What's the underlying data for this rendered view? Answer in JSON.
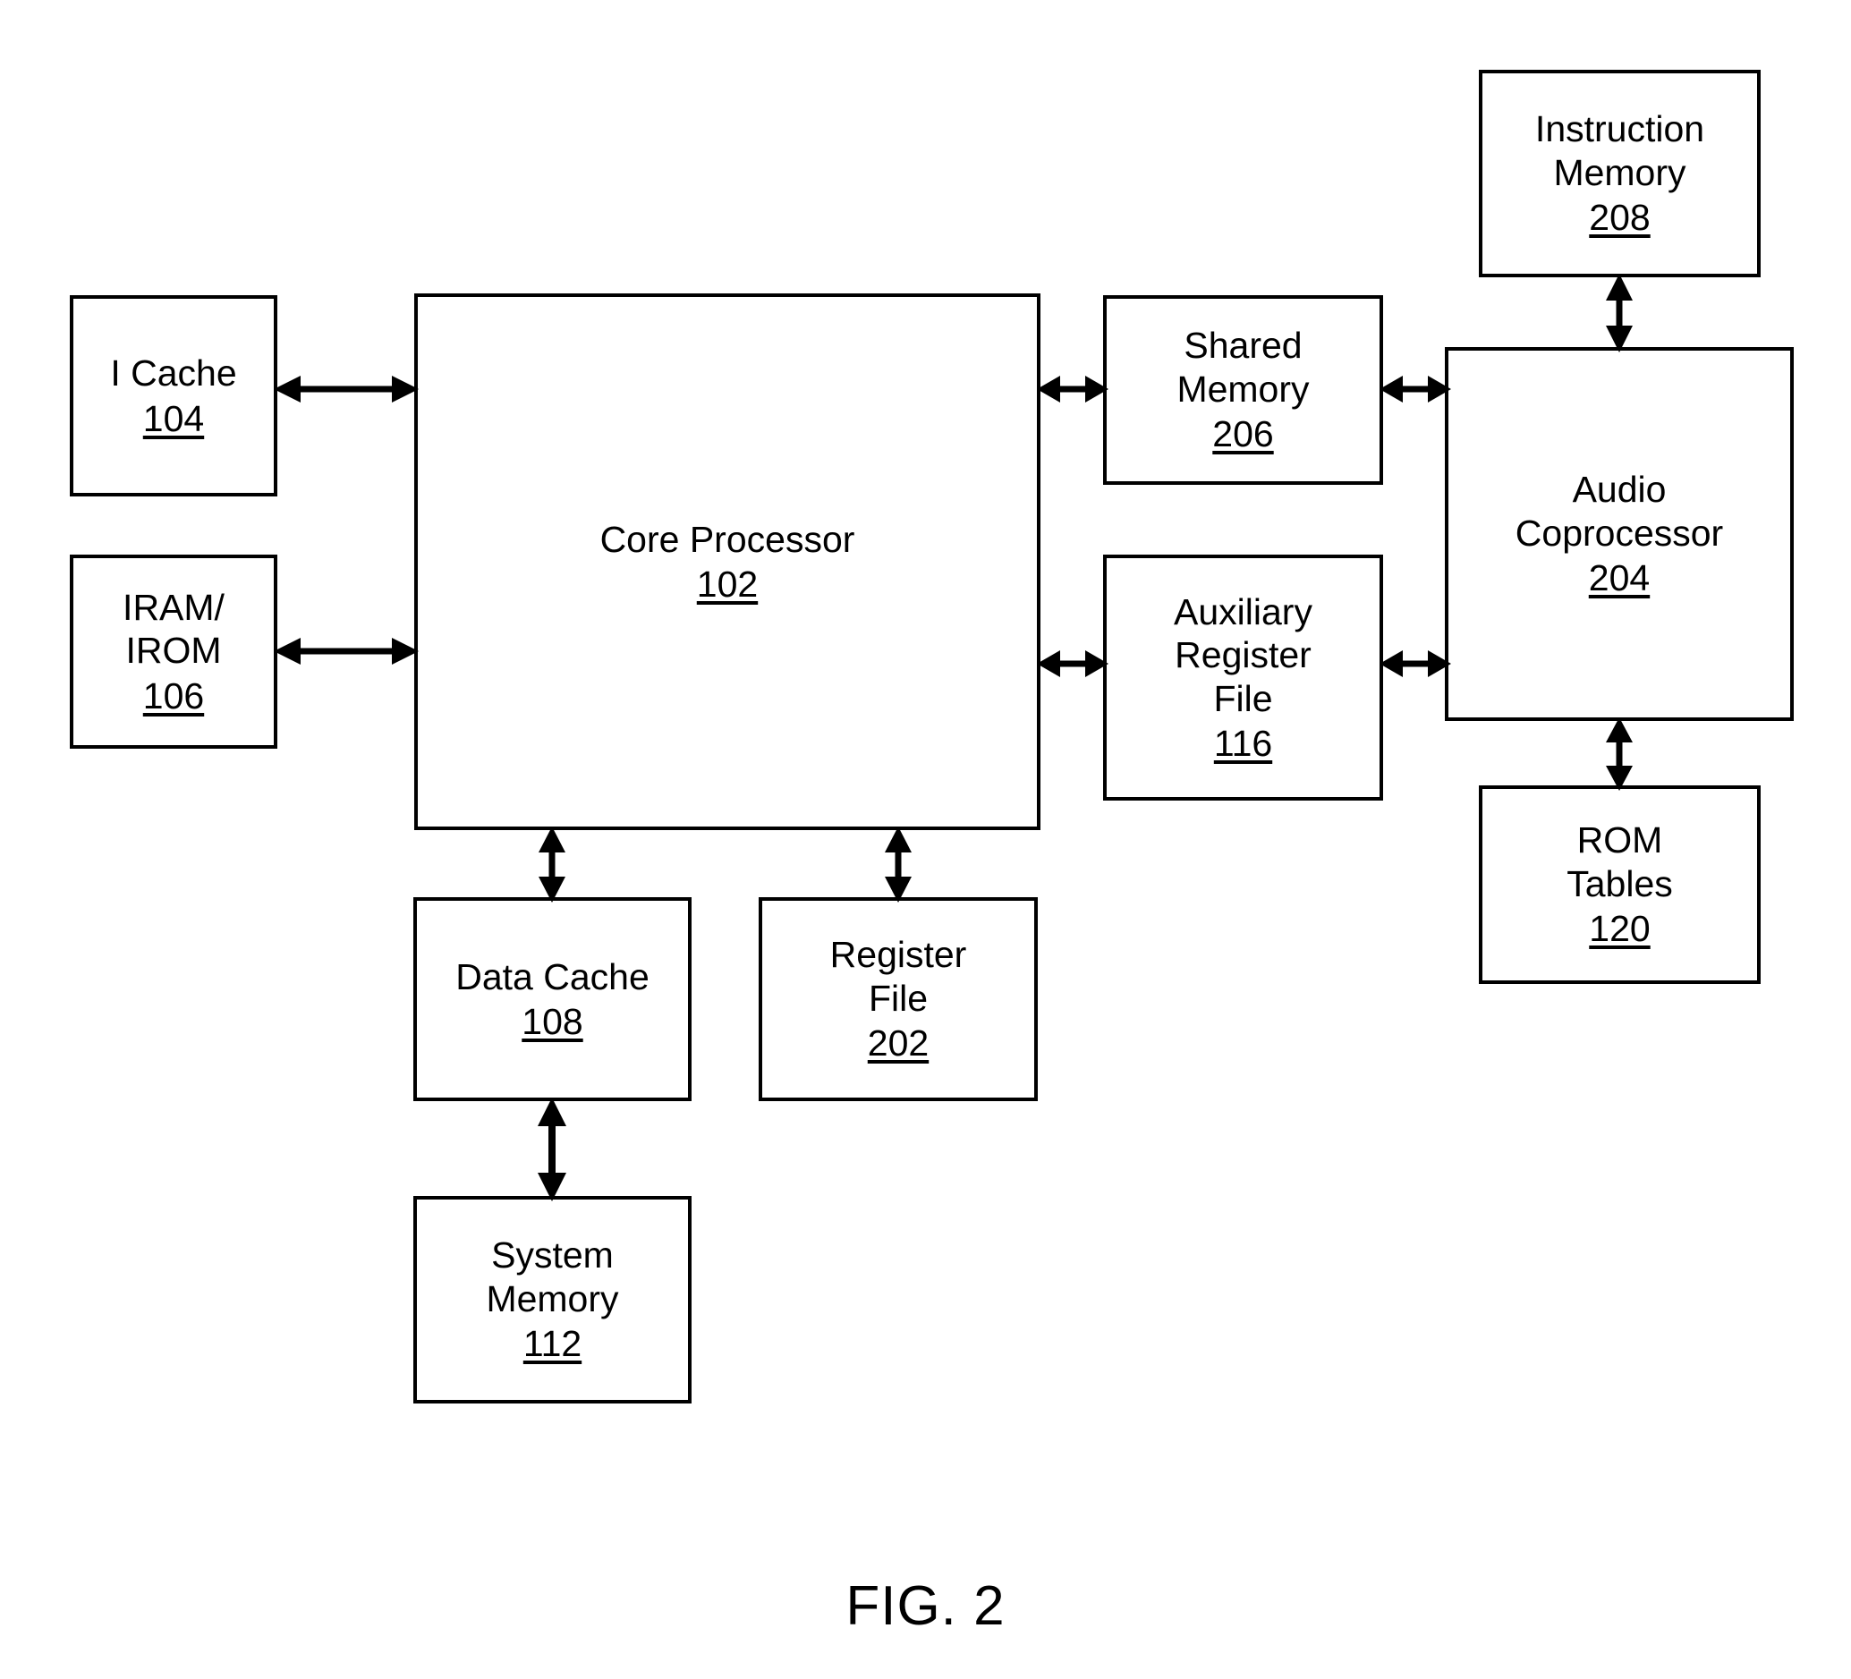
{
  "figure": {
    "caption": "FIG. 2",
    "type": "block-diagram",
    "line_color": "#000000",
    "background_color": "#ffffff"
  },
  "blocks": [
    {
      "id": "i-cache",
      "label": "I Cache",
      "ref": "104"
    },
    {
      "id": "iram-irom",
      "label": "IRAM/\nIROM",
      "ref": "106"
    },
    {
      "id": "core-processor",
      "label": "Core Processor",
      "ref": "102"
    },
    {
      "id": "shared-memory",
      "label": "Shared\nMemory",
      "ref": "206"
    },
    {
      "id": "auxiliary-register-file",
      "label": "Auxiliary\nRegister\nFile",
      "ref": "116"
    },
    {
      "id": "instruction-memory",
      "label": "Instruction\nMemory",
      "ref": "208"
    },
    {
      "id": "audio-coprocessor",
      "label": "Audio\nCoprocessor",
      "ref": "204"
    },
    {
      "id": "rom-tables",
      "label": "ROM\nTables",
      "ref": "120"
    },
    {
      "id": "data-cache",
      "label": "Data Cache",
      "ref": "108"
    },
    {
      "id": "register-file",
      "label": "Register\nFile",
      "ref": "202"
    },
    {
      "id": "system-memory",
      "label": "System\nMemory",
      "ref": "112"
    }
  ],
  "connections": [
    {
      "id": "i-cache--core-processor",
      "from": "i-cache",
      "to": "core-processor",
      "style": "double-arrow",
      "orientation": "horizontal"
    },
    {
      "id": "iram-irom--core-processor",
      "from": "iram-irom",
      "to": "core-processor",
      "style": "double-arrow",
      "orientation": "horizontal"
    },
    {
      "id": "core-processor--shared-memory",
      "from": "core-processor",
      "to": "shared-memory",
      "style": "double-arrow",
      "orientation": "horizontal"
    },
    {
      "id": "core-processor--auxiliary-register-file",
      "from": "core-processor",
      "to": "auxiliary-register-file",
      "style": "double-arrow",
      "orientation": "horizontal"
    },
    {
      "id": "shared-memory--audio-coprocessor",
      "from": "shared-memory",
      "to": "audio-coprocessor",
      "style": "double-arrow",
      "orientation": "horizontal"
    },
    {
      "id": "auxiliary-register-file--audio-coprocessor",
      "from": "auxiliary-register-file",
      "to": "audio-coprocessor",
      "style": "double-arrow",
      "orientation": "horizontal"
    },
    {
      "id": "instruction-memory--audio-coprocessor",
      "from": "instruction-memory",
      "to": "audio-coprocessor",
      "style": "double-arrow",
      "orientation": "vertical"
    },
    {
      "id": "audio-coprocessor--rom-tables",
      "from": "audio-coprocessor",
      "to": "rom-tables",
      "style": "double-arrow",
      "orientation": "vertical"
    },
    {
      "id": "core-processor--data-cache",
      "from": "core-processor",
      "to": "data-cache",
      "style": "double-arrow",
      "orientation": "vertical"
    },
    {
      "id": "core-processor--register-file",
      "from": "core-processor",
      "to": "register-file",
      "style": "double-arrow",
      "orientation": "vertical"
    },
    {
      "id": "data-cache--system-memory",
      "from": "data-cache",
      "to": "system-memory",
      "style": "double-arrow",
      "orientation": "vertical"
    }
  ]
}
